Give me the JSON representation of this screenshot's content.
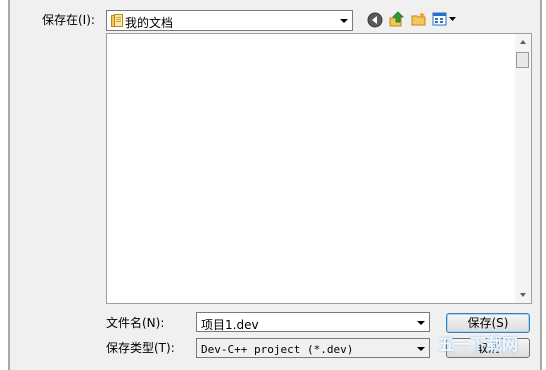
{
  "save_in": {
    "label": "保存在(I):",
    "current_folder": "我的文档"
  },
  "toolbar": {
    "back_icon": "back-icon",
    "up_icon": "up-folder-icon",
    "new_folder_icon": "new-folder-icon",
    "views_icon": "views-menu-icon"
  },
  "filename": {
    "label": "文件名(N):",
    "value": "项目1.dev"
  },
  "filetype": {
    "label": "保存类型(T):",
    "value": "Dev-C++ project (*.dev)"
  },
  "buttons": {
    "save_label": "保存(S)",
    "cancel_label": "取消"
  },
  "watermark": {
    "text": "五一下载网"
  },
  "colors": {
    "panel": "#f0f0f0",
    "default_button_border": "#3c7fb1",
    "up_arrow": "#e8a000",
    "back_button": "#5a5a5a"
  }
}
